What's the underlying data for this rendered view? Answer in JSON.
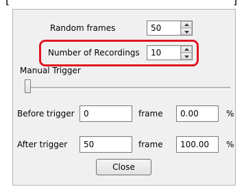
{
  "top_fragment": {
    "left_bracket": "[",
    "right_bracket": "]"
  },
  "random_frames": {
    "label": "Random frames",
    "value": "50"
  },
  "number_of_recordings": {
    "label": "Number of Recordings",
    "value": "10"
  },
  "manual_trigger": {
    "label": "Manual Trigger",
    "position": 0
  },
  "before_trigger": {
    "label": "Before trigger",
    "frames_value": "0",
    "frames_unit": "frame",
    "percent_value": "0.00",
    "percent_unit": "%"
  },
  "after_trigger": {
    "label": "After trigger",
    "frames_value": "50",
    "frames_unit": "frame",
    "percent_value": "100.00",
    "percent_unit": "%"
  },
  "close_button": {
    "label": "Close"
  },
  "colors": {
    "highlight": "#e0141e",
    "panel_bg": "#f0f0f0"
  }
}
